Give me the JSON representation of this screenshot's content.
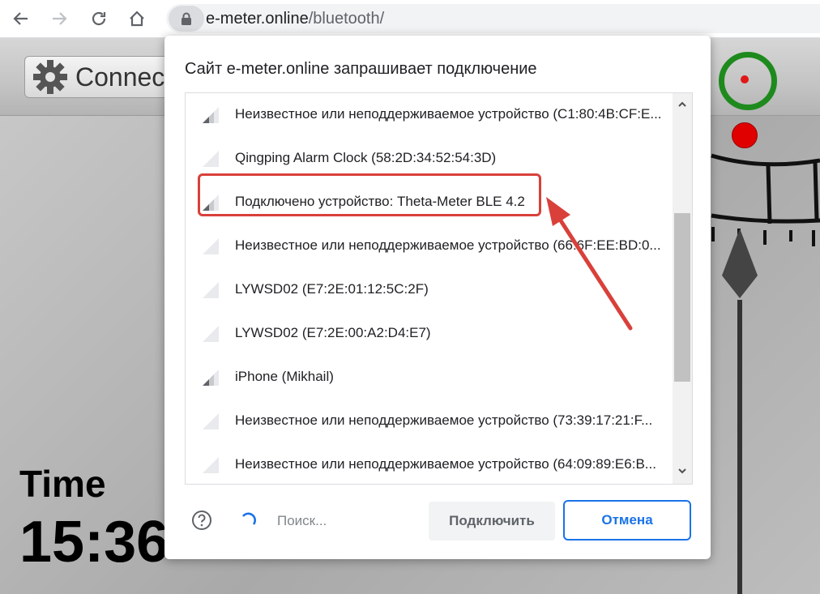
{
  "browser": {
    "url_host": "e-meter.online",
    "url_path": "/bluetooth/"
  },
  "page": {
    "connect_label": "Connect",
    "time_label": "Time",
    "time_value": "15:36"
  },
  "dialog": {
    "title": "Сайт e-meter.online запрашивает подключение",
    "devices": [
      {
        "name": "Неизвестное или неподдерживаемое устройство (C1:80:4B:CF:E...",
        "signal": "weak"
      },
      {
        "name": "Qingping Alarm Clock (58:2D:34:52:54:3D)",
        "signal": "none"
      },
      {
        "name": "Подключено устройство: Theta-Meter BLE 4.2",
        "signal": "weak",
        "highlighted": true
      },
      {
        "name": "Неизвестное или неподдерживаемое устройство (66:6F:EE:BD:0...",
        "signal": "none"
      },
      {
        "name": "LYWSD02 (E7:2E:01:12:5C:2F)",
        "signal": "none"
      },
      {
        "name": "LYWSD02 (E7:2E:00:A2:D4:E7)",
        "signal": "none"
      },
      {
        "name": "iPhone (Mikhail)",
        "signal": "weak"
      },
      {
        "name": "Неизвестное или неподдерживаемое устройство (73:39:17:21:F...",
        "signal": "none"
      },
      {
        "name": "Неизвестное или неподдерживаемое устройство (64:09:89:E6:B...",
        "signal": "none"
      }
    ],
    "search_text": "Поиск...",
    "connect_button": "Подключить",
    "cancel_button": "Отмена"
  },
  "colors": {
    "accent": "#1a73e8",
    "highlight": "#d9403a",
    "status_ring": "#1e8a1e",
    "status_dot": "#e01818"
  }
}
